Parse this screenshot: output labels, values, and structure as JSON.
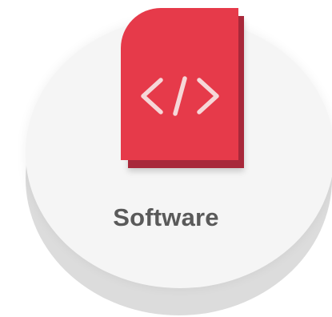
{
  "card": {
    "label": "Software",
    "icon": "code-brackets-icon",
    "colors": {
      "accent": "#e63a4a",
      "accent_shadow": "#a8283a",
      "disc": "#f5f5f5",
      "disc_shadow": "#dcdcdc",
      "label": "#5a5a5a"
    }
  }
}
